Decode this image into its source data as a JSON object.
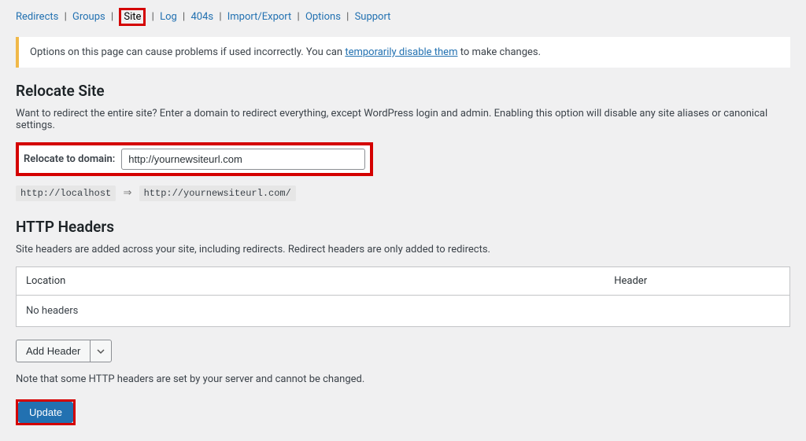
{
  "tabs": {
    "redirects": "Redirects",
    "groups": "Groups",
    "site": "Site",
    "log": "Log",
    "fourohfours": "404s",
    "importexport": "Import/Export",
    "options": "Options",
    "support": "Support"
  },
  "notice": {
    "prefix": "Options on this page can cause problems if used incorrectly. You can ",
    "link": "temporarily disable them",
    "suffix": " to make changes."
  },
  "relocate": {
    "heading": "Relocate Site",
    "desc": "Want to redirect the entire site? Enter a domain to redirect everything, except WordPress login and admin. Enabling this option will disable any site aliases or canonical settings.",
    "label": "Relocate to domain:",
    "value": "http://yournewsiteurl.com",
    "example_from": "http://localhost",
    "example_to": "http://yournewsiteurl.com/",
    "arrow": "⇒"
  },
  "headers": {
    "heading": "HTTP Headers",
    "desc": "Site headers are added across your site, including redirects. Redirect headers are only added to redirects.",
    "col_location": "Location",
    "col_header": "Header",
    "empty": "No headers",
    "add_label": "Add Header",
    "note": "Note that some HTTP headers are set by your server and cannot be changed."
  },
  "buttons": {
    "update": "Update"
  }
}
